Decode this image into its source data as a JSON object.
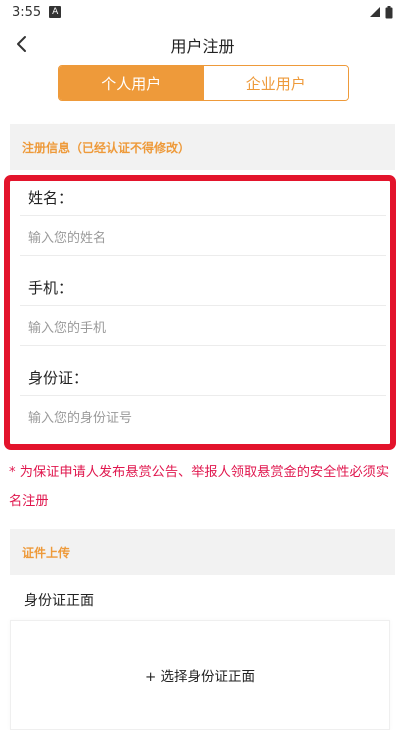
{
  "status_bar": {
    "time": "3:55",
    "notification_icon": "A"
  },
  "nav": {
    "title": "用户注册"
  },
  "tabs": [
    {
      "label": "个人用户",
      "active": true
    },
    {
      "label": "企业用户",
      "active": false
    }
  ],
  "registration_section": {
    "title": "注册信息（已经认证不得修改）"
  },
  "fields": [
    {
      "label": "姓名：",
      "placeholder": "输入您的姓名",
      "value": ""
    },
    {
      "label": "手机：",
      "placeholder": "输入您的手机",
      "value": ""
    },
    {
      "label": "身份证：",
      "placeholder": "输入您的身份证号",
      "value": ""
    }
  ],
  "notice": "* 为保证申请人发布悬赏公告、举报人领取悬赏金的安全性必须实名注册",
  "upload_section": {
    "title": "证件上传",
    "id_front_label": "身份证正面",
    "id_front_button": "+ 选择身份证正面"
  },
  "colors": {
    "accent": "#EE9A3A",
    "highlight_border": "#E3142C",
    "notice": "#E0174E",
    "section_bg": "#F2F2F2"
  }
}
